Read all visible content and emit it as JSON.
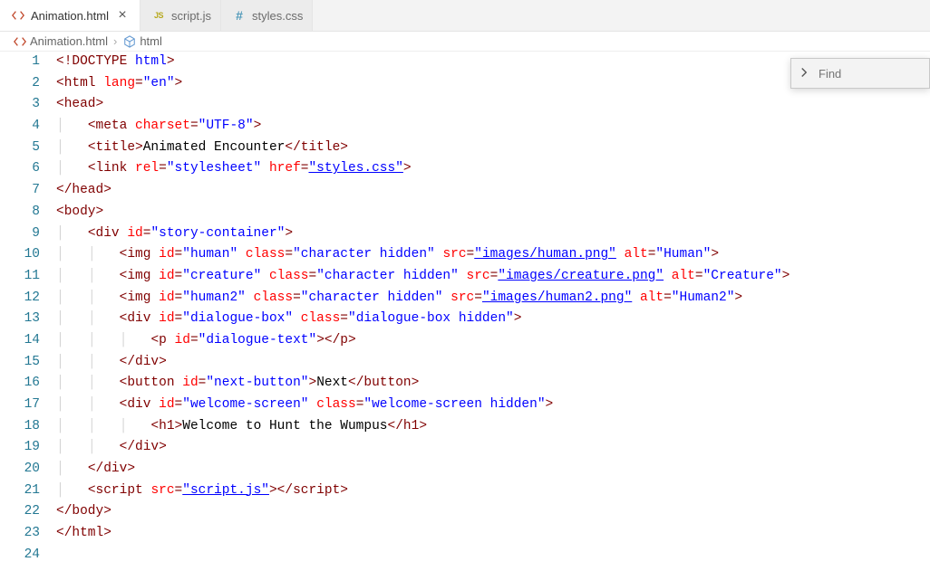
{
  "tabs": [
    {
      "label": "Animation.html",
      "icon": "html",
      "active": true
    },
    {
      "label": "script.js",
      "icon": "js",
      "active": false
    },
    {
      "label": "styles.css",
      "icon": "css",
      "active": false
    }
  ],
  "breadcrumb": {
    "file": "Animation.html",
    "symbol": "html"
  },
  "find": {
    "placeholder": "Find"
  },
  "code": {
    "lines": [
      {
        "n": 1,
        "indent": 0,
        "tokens": [
          [
            "punc",
            "<!"
          ],
          [
            "doctype",
            "DOCTYPE"
          ],
          [
            "text",
            " "
          ],
          [
            "doctype-word",
            "html"
          ],
          [
            "punc",
            ">"
          ]
        ]
      },
      {
        "n": 2,
        "indent": 0,
        "tokens": [
          [
            "punc",
            "<"
          ],
          [
            "tag",
            "html"
          ],
          [
            "text",
            " "
          ],
          [
            "attr",
            "lang"
          ],
          [
            "punc",
            "="
          ],
          [
            "str",
            "\"en\""
          ],
          [
            "punc",
            ">"
          ]
        ]
      },
      {
        "n": 3,
        "indent": 0,
        "tokens": [
          [
            "punc",
            "<"
          ],
          [
            "tag",
            "head"
          ],
          [
            "punc",
            ">"
          ]
        ]
      },
      {
        "n": 4,
        "indent": 1,
        "tokens": [
          [
            "punc",
            "<"
          ],
          [
            "tag",
            "meta"
          ],
          [
            "text",
            " "
          ],
          [
            "attr",
            "charset"
          ],
          [
            "punc",
            "="
          ],
          [
            "str",
            "\"UTF-8\""
          ],
          [
            "punc",
            ">"
          ]
        ]
      },
      {
        "n": 5,
        "indent": 1,
        "tokens": [
          [
            "punc",
            "<"
          ],
          [
            "tag",
            "title"
          ],
          [
            "punc",
            ">"
          ],
          [
            "text",
            "Animated Encounter"
          ],
          [
            "punc",
            "</"
          ],
          [
            "tag",
            "title"
          ],
          [
            "punc",
            ">"
          ]
        ]
      },
      {
        "n": 6,
        "indent": 1,
        "tokens": [
          [
            "punc",
            "<"
          ],
          [
            "tag",
            "link"
          ],
          [
            "text",
            " "
          ],
          [
            "attr",
            "rel"
          ],
          [
            "punc",
            "="
          ],
          [
            "str",
            "\"stylesheet\""
          ],
          [
            "text",
            " "
          ],
          [
            "attr",
            "href"
          ],
          [
            "punc",
            "="
          ],
          [
            "str-u",
            "\"styles.css\""
          ],
          [
            "punc",
            ">"
          ]
        ]
      },
      {
        "n": 7,
        "indent": 0,
        "tokens": [
          [
            "punc",
            "</"
          ],
          [
            "tag",
            "head"
          ],
          [
            "punc",
            ">"
          ]
        ]
      },
      {
        "n": 8,
        "indent": 0,
        "tokens": [
          [
            "punc",
            "<"
          ],
          [
            "tag",
            "body"
          ],
          [
            "punc",
            ">"
          ]
        ]
      },
      {
        "n": 9,
        "indent": 1,
        "tokens": [
          [
            "punc",
            "<"
          ],
          [
            "tag",
            "div"
          ],
          [
            "text",
            " "
          ],
          [
            "attr",
            "id"
          ],
          [
            "punc",
            "="
          ],
          [
            "str",
            "\"story-container\""
          ],
          [
            "punc",
            ">"
          ]
        ]
      },
      {
        "n": 10,
        "indent": 2,
        "tokens": [
          [
            "punc",
            "<"
          ],
          [
            "tag",
            "img"
          ],
          [
            "text",
            " "
          ],
          [
            "attr",
            "id"
          ],
          [
            "punc",
            "="
          ],
          [
            "str",
            "\"human\""
          ],
          [
            "text",
            " "
          ],
          [
            "attr",
            "class"
          ],
          [
            "punc",
            "="
          ],
          [
            "str",
            "\"character hidden\""
          ],
          [
            "text",
            " "
          ],
          [
            "attr",
            "src"
          ],
          [
            "punc",
            "="
          ],
          [
            "str-u",
            "\"images/human.png\""
          ],
          [
            "text",
            " "
          ],
          [
            "attr",
            "alt"
          ],
          [
            "punc",
            "="
          ],
          [
            "str",
            "\"Human\""
          ],
          [
            "punc",
            ">"
          ]
        ]
      },
      {
        "n": 11,
        "indent": 2,
        "tokens": [
          [
            "punc",
            "<"
          ],
          [
            "tag",
            "img"
          ],
          [
            "text",
            " "
          ],
          [
            "attr",
            "id"
          ],
          [
            "punc",
            "="
          ],
          [
            "str",
            "\"creature\""
          ],
          [
            "text",
            " "
          ],
          [
            "attr",
            "class"
          ],
          [
            "punc",
            "="
          ],
          [
            "str",
            "\"character hidden\""
          ],
          [
            "text",
            " "
          ],
          [
            "attr",
            "src"
          ],
          [
            "punc",
            "="
          ],
          [
            "str-u",
            "\"images/creature.png\""
          ],
          [
            "text",
            " "
          ],
          [
            "attr",
            "alt"
          ],
          [
            "punc",
            "="
          ],
          [
            "str",
            "\"Creature\""
          ],
          [
            "punc",
            ">"
          ]
        ]
      },
      {
        "n": 12,
        "indent": 2,
        "tokens": [
          [
            "punc",
            "<"
          ],
          [
            "tag",
            "img"
          ],
          [
            "text",
            " "
          ],
          [
            "attr",
            "id"
          ],
          [
            "punc",
            "="
          ],
          [
            "str",
            "\"human2\""
          ],
          [
            "text",
            " "
          ],
          [
            "attr",
            "class"
          ],
          [
            "punc",
            "="
          ],
          [
            "str",
            "\"character hidden\""
          ],
          [
            "text",
            " "
          ],
          [
            "attr",
            "src"
          ],
          [
            "punc",
            "="
          ],
          [
            "str-u",
            "\"images/human2.png\""
          ],
          [
            "text",
            " "
          ],
          [
            "attr",
            "alt"
          ],
          [
            "punc",
            "="
          ],
          [
            "str",
            "\"Human2\""
          ],
          [
            "punc",
            ">"
          ]
        ]
      },
      {
        "n": 13,
        "indent": 2,
        "tokens": [
          [
            "punc",
            "<"
          ],
          [
            "tag",
            "div"
          ],
          [
            "text",
            " "
          ],
          [
            "attr",
            "id"
          ],
          [
            "punc",
            "="
          ],
          [
            "str",
            "\"dialogue-box\""
          ],
          [
            "text",
            " "
          ],
          [
            "attr",
            "class"
          ],
          [
            "punc",
            "="
          ],
          [
            "str",
            "\"dialogue-box hidden\""
          ],
          [
            "punc",
            ">"
          ]
        ]
      },
      {
        "n": 14,
        "indent": 3,
        "tokens": [
          [
            "punc",
            "<"
          ],
          [
            "tag",
            "p"
          ],
          [
            "text",
            " "
          ],
          [
            "attr",
            "id"
          ],
          [
            "punc",
            "="
          ],
          [
            "str",
            "\"dialogue-text\""
          ],
          [
            "punc",
            "></"
          ],
          [
            "tag",
            "p"
          ],
          [
            "punc",
            ">"
          ]
        ]
      },
      {
        "n": 15,
        "indent": 2,
        "tokens": [
          [
            "punc",
            "</"
          ],
          [
            "tag",
            "div"
          ],
          [
            "punc",
            ">"
          ]
        ]
      },
      {
        "n": 16,
        "indent": 2,
        "tokens": [
          [
            "punc",
            "<"
          ],
          [
            "tag",
            "button"
          ],
          [
            "text",
            " "
          ],
          [
            "attr",
            "id"
          ],
          [
            "punc",
            "="
          ],
          [
            "str",
            "\"next-button\""
          ],
          [
            "punc",
            ">"
          ],
          [
            "text",
            "Next"
          ],
          [
            "punc",
            "</"
          ],
          [
            "tag",
            "button"
          ],
          [
            "punc",
            ">"
          ]
        ]
      },
      {
        "n": 17,
        "indent": 2,
        "tokens": [
          [
            "punc",
            "<"
          ],
          [
            "tag",
            "div"
          ],
          [
            "text",
            " "
          ],
          [
            "attr",
            "id"
          ],
          [
            "punc",
            "="
          ],
          [
            "str",
            "\"welcome-screen\""
          ],
          [
            "text",
            " "
          ],
          [
            "attr",
            "class"
          ],
          [
            "punc",
            "="
          ],
          [
            "str",
            "\"welcome-screen hidden\""
          ],
          [
            "punc",
            ">"
          ]
        ]
      },
      {
        "n": 18,
        "indent": 3,
        "tokens": [
          [
            "punc",
            "<"
          ],
          [
            "tag",
            "h1"
          ],
          [
            "punc",
            ">"
          ],
          [
            "text",
            "Welcome to Hunt the Wumpus"
          ],
          [
            "punc",
            "</"
          ],
          [
            "tag",
            "h1"
          ],
          [
            "punc",
            ">"
          ]
        ]
      },
      {
        "n": 19,
        "indent": 2,
        "tokens": [
          [
            "punc",
            "</"
          ],
          [
            "tag",
            "div"
          ],
          [
            "punc",
            ">"
          ]
        ]
      },
      {
        "n": 20,
        "indent": 1,
        "tokens": [
          [
            "punc",
            "</"
          ],
          [
            "tag",
            "div"
          ],
          [
            "punc",
            ">"
          ]
        ]
      },
      {
        "n": 21,
        "indent": 1,
        "tokens": [
          [
            "punc",
            "<"
          ],
          [
            "tag",
            "script"
          ],
          [
            "text",
            " "
          ],
          [
            "attr",
            "src"
          ],
          [
            "punc",
            "="
          ],
          [
            "str-u",
            "\"script.js\""
          ],
          [
            "punc",
            "></"
          ],
          [
            "tag",
            "script"
          ],
          [
            "punc",
            ">"
          ]
        ]
      },
      {
        "n": 22,
        "indent": 0,
        "tokens": [
          [
            "punc",
            "</"
          ],
          [
            "tag",
            "body"
          ],
          [
            "punc",
            ">"
          ]
        ]
      },
      {
        "n": 23,
        "indent": 0,
        "tokens": [
          [
            "punc",
            "</"
          ],
          [
            "tag",
            "html"
          ],
          [
            "punc",
            ">"
          ]
        ]
      },
      {
        "n": 24,
        "indent": 0,
        "tokens": []
      }
    ]
  }
}
